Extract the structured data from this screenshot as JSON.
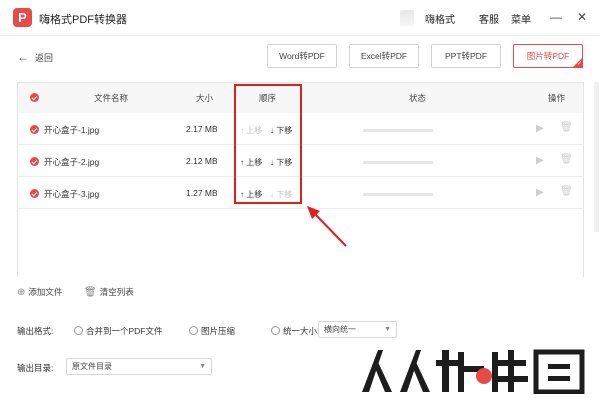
{
  "app": {
    "logo_letter": "P",
    "title": "嗨格式PDF转换器"
  },
  "titlebar": {
    "menu": [
      "嗨格式",
      "客服",
      "菜单"
    ],
    "minimize": "—",
    "close": "✕"
  },
  "toolbar": {
    "back_label": "返回",
    "modes": [
      {
        "label": "Word转PDF",
        "active": false
      },
      {
        "label": "Excel转PDF",
        "active": false
      },
      {
        "label": "PPT转PDF",
        "active": false
      },
      {
        "label": "图片转PDF",
        "active": true
      }
    ]
  },
  "table": {
    "headers": {
      "name": "文件名称",
      "size": "大小",
      "order": "顺序",
      "status": "状态",
      "actions": "操作"
    },
    "move_up": "上移",
    "move_down": "下移",
    "rows": [
      {
        "name": "开心盒子-1.jpg",
        "size": "2.17 MB",
        "up_enabled": false,
        "down_enabled": true,
        "progress": 0
      },
      {
        "name": "开心盒子-2.jpg",
        "size": "2.12 MB",
        "up_enabled": true,
        "down_enabled": true,
        "progress": 0
      },
      {
        "name": "开心盒子-3.jpg",
        "size": "1.27 MB",
        "up_enabled": true,
        "down_enabled": false,
        "progress": 0
      }
    ]
  },
  "file_actions": {
    "add": "添加文件",
    "clear": "清空列表"
  },
  "output_format": {
    "label": "输出格式:",
    "options": [
      "合并到一个PDF文件",
      "图片压缩",
      "统一大小:"
    ],
    "size_select": "横向统一"
  },
  "output_dir": {
    "label": "输出目录:",
    "value": "原文件目录"
  },
  "watermark": {
    "text": "人人软件园"
  },
  "colors": {
    "accent": "#e84a4a",
    "highlight": "#e02020"
  }
}
